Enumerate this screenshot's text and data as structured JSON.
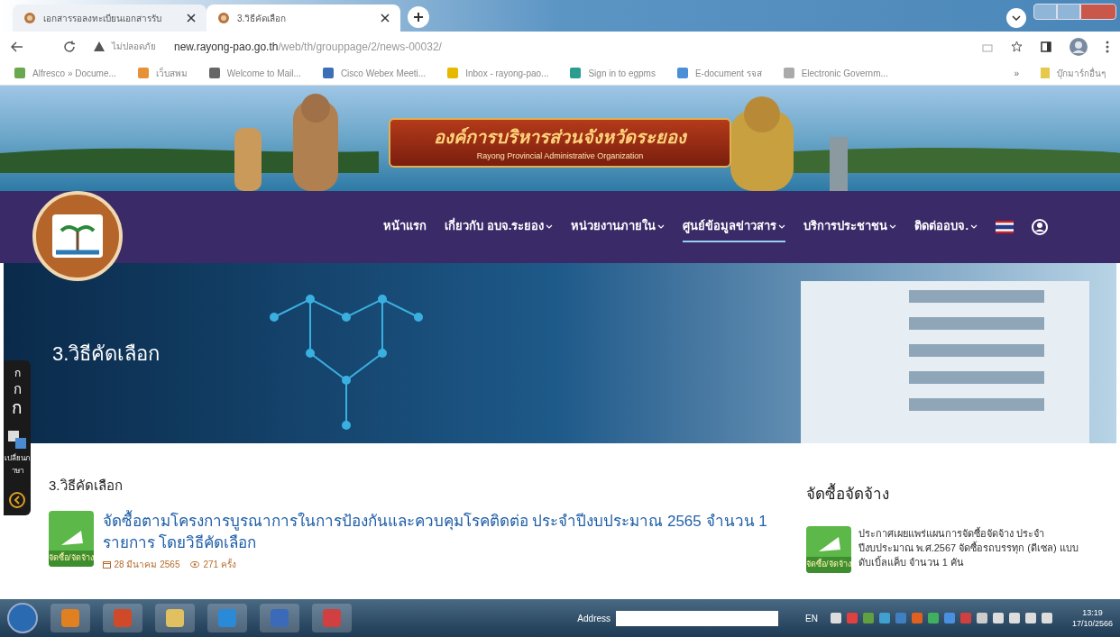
{
  "browser": {
    "tabs": [
      {
        "title": "เอกสารรอลงทะเบียนเอกสารรับ",
        "selected": false
      },
      {
        "title": "3.วิธีคัดเลือก",
        "selected": true
      }
    ],
    "security": "ไม่ปลอดภัย",
    "url_host": "new.rayong-pao.go.th",
    "url_path": "/web/th/grouppage/2/news-00032/",
    "bookmarks": [
      "Alfresco » Docume...",
      "เว็บสพม",
      "Welcome to Mail...",
      "Cisco Webex Meeti...",
      "Inbox - rayong-pao...",
      "Sign in to egpms",
      "E-document รจส",
      "Electronic Governm..."
    ],
    "bookmarks_more": "»",
    "other_bookmarks": "บุ๊กมาร์กอื่นๆ"
  },
  "banner": {
    "title": "องค์การบริหารส่วนจังหวัดระยอง",
    "subtitle": "Rayong Provincial Administrative Organization"
  },
  "nav": [
    {
      "label": "หน้าแรก",
      "dropdown": false,
      "selected": false
    },
    {
      "label": "เกี่ยวกับ อบจ.ระยอง",
      "dropdown": true,
      "selected": false
    },
    {
      "label": "หน่วยงานภายใน",
      "dropdown": true,
      "selected": false
    },
    {
      "label": "ศูนย์ข้อมูลข่าวสาร",
      "dropdown": true,
      "selected": true
    },
    {
      "label": "บริการประชาชน",
      "dropdown": true,
      "selected": false
    },
    {
      "label": "ติดต่ออบจ.",
      "dropdown": true,
      "selected": false
    }
  ],
  "hero_title": "3.วิธีคัดเลือก",
  "side_tools": {
    "font_sizes": [
      "ก",
      "ก",
      "ก"
    ],
    "language": "เปลี่ยนภาษา"
  },
  "section_title": "3.วิธีคัดเลือก",
  "news": [
    {
      "badge": "จัดซื้อ/จัดจ้าง",
      "title": "จัดซื้อตามโครงการบูรณาการในการป้องกันและควบคุมโรคติดต่อ ประจำปีงบประมาณ 2565 จำนวน 1 รายการ โดยวิธีคัดเลือก",
      "date": "28 มีนาคม 2565",
      "views": "271 ครั้ง"
    }
  ],
  "sidebar": {
    "title": "จัดซื้อจัดจ้าง",
    "items": [
      {
        "badge": "จัดซื้อ/จัดจ้าง",
        "text": "ประกาศเผยแพร่แผนการจัดซื้อจัดจ้าง ประจำปีงบประมาณ พ.ศ.2567 จัดซื้อรถบรรทุก (ดีเซล) แบบดับเบิ้ลแค็บ จำนวน 1 คัน"
      }
    ]
  },
  "taskbar": {
    "address_label": "Address",
    "language": "EN",
    "time": "13:19",
    "date": "17/10/2566"
  }
}
